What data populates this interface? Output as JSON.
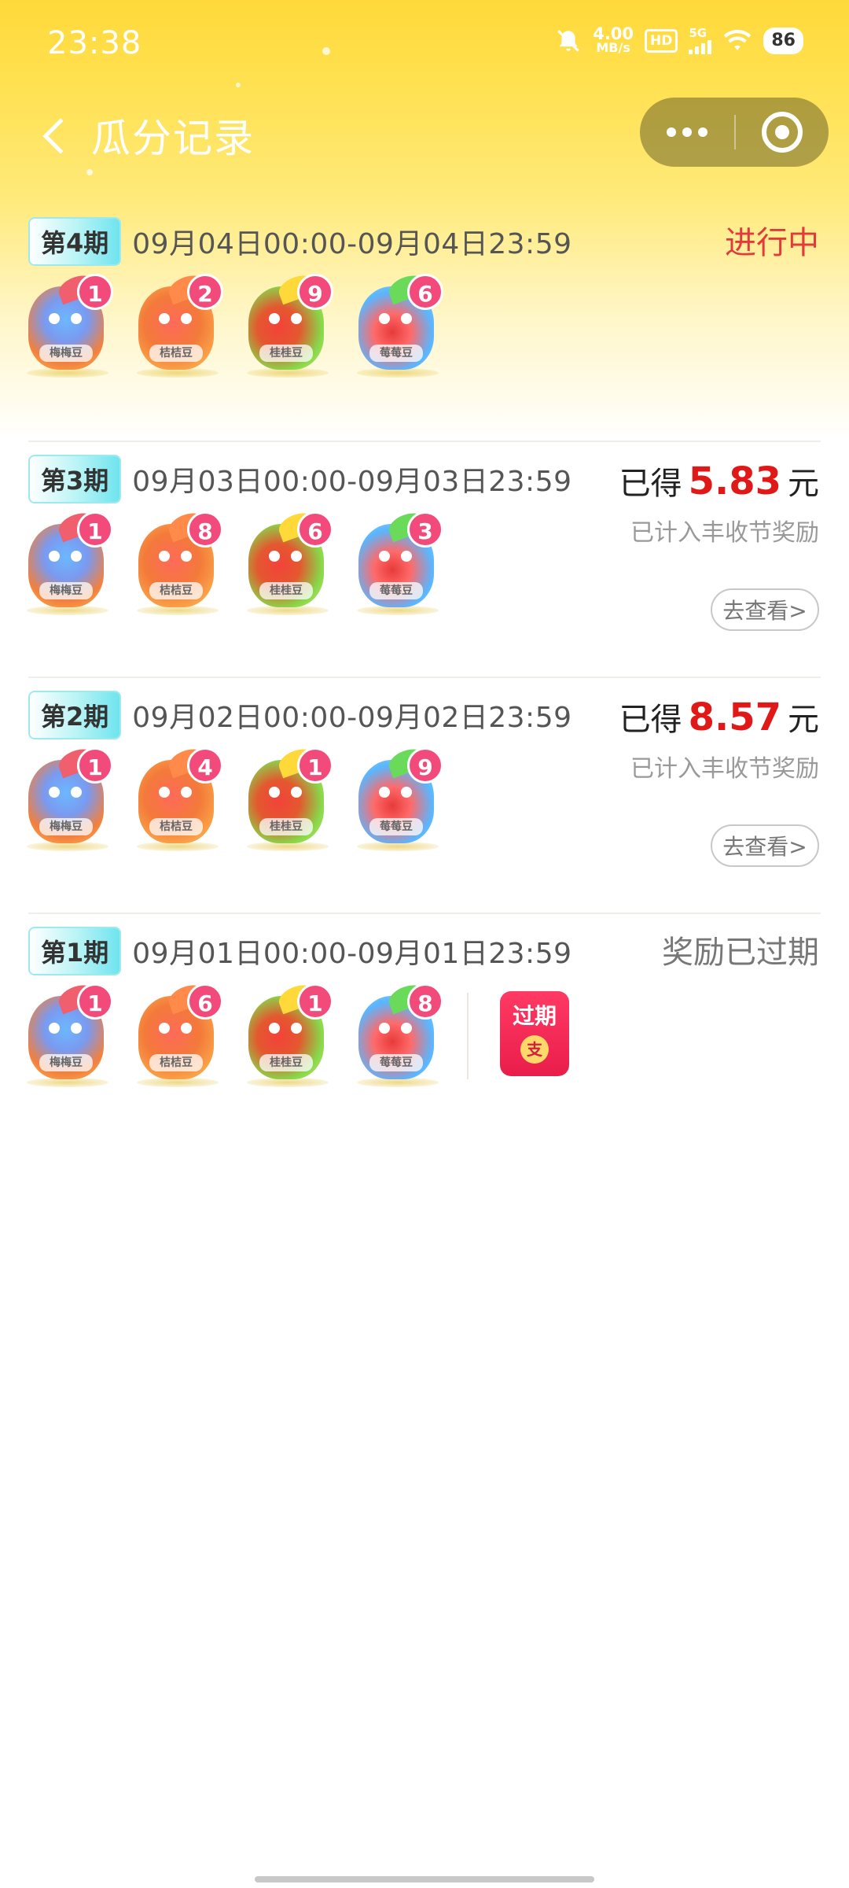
{
  "status_bar": {
    "time": "23:38",
    "net_speed_value": "4.00",
    "net_speed_unit": "MB/s",
    "hd_label": "HD",
    "network_label": "5G",
    "battery": "86"
  },
  "nav": {
    "title": "瓜分记录"
  },
  "colors": {
    "header_gradient_top": "#ffd93a",
    "amount_red": "#e01818",
    "in_progress_red": "#e23a3a",
    "count_badge": "#f24a7a",
    "expired_gray": "#777777"
  },
  "periods": [
    {
      "badge": "第4期",
      "date_range": "09月04日00:00-09月04日23:59",
      "status": "进行中",
      "fruits": [
        {
          "label": "梅梅豆",
          "count": "1"
        },
        {
          "label": "桔桔豆",
          "count": "2"
        },
        {
          "label": "桂桂豆",
          "count": "9"
        },
        {
          "label": "莓莓豆",
          "count": "6"
        }
      ]
    },
    {
      "badge": "第3期",
      "date_range": "09月03日00:00-09月03日23:59",
      "earned_prefix": "已得",
      "earned_amount": "5.83",
      "earned_unit": "元",
      "note": "已计入丰收节奖励",
      "view_button": "去查看>",
      "fruits": [
        {
          "label": "梅梅豆",
          "count": "1"
        },
        {
          "label": "桔桔豆",
          "count": "8"
        },
        {
          "label": "桂桂豆",
          "count": "6"
        },
        {
          "label": "莓莓豆",
          "count": "3"
        }
      ]
    },
    {
      "badge": "第2期",
      "date_range": "09月02日00:00-09月02日23:59",
      "earned_prefix": "已得",
      "earned_amount": "8.57",
      "earned_unit": "元",
      "note": "已计入丰收节奖励",
      "view_button": "去查看>",
      "fruits": [
        {
          "label": "梅梅豆",
          "count": "1"
        },
        {
          "label": "桔桔豆",
          "count": "4"
        },
        {
          "label": "桂桂豆",
          "count": "1"
        },
        {
          "label": "莓莓豆",
          "count": "9"
        }
      ]
    },
    {
      "badge": "第1期",
      "date_range": "09月01日00:00-09月01日23:59",
      "status": "奖励已过期",
      "expired_pack_label": "过期",
      "expired_pack_coin": "支",
      "fruits": [
        {
          "label": "梅梅豆",
          "count": "1"
        },
        {
          "label": "桔桔豆",
          "count": "6"
        },
        {
          "label": "桂桂豆",
          "count": "1"
        },
        {
          "label": "莓莓豆",
          "count": "8"
        }
      ]
    }
  ]
}
